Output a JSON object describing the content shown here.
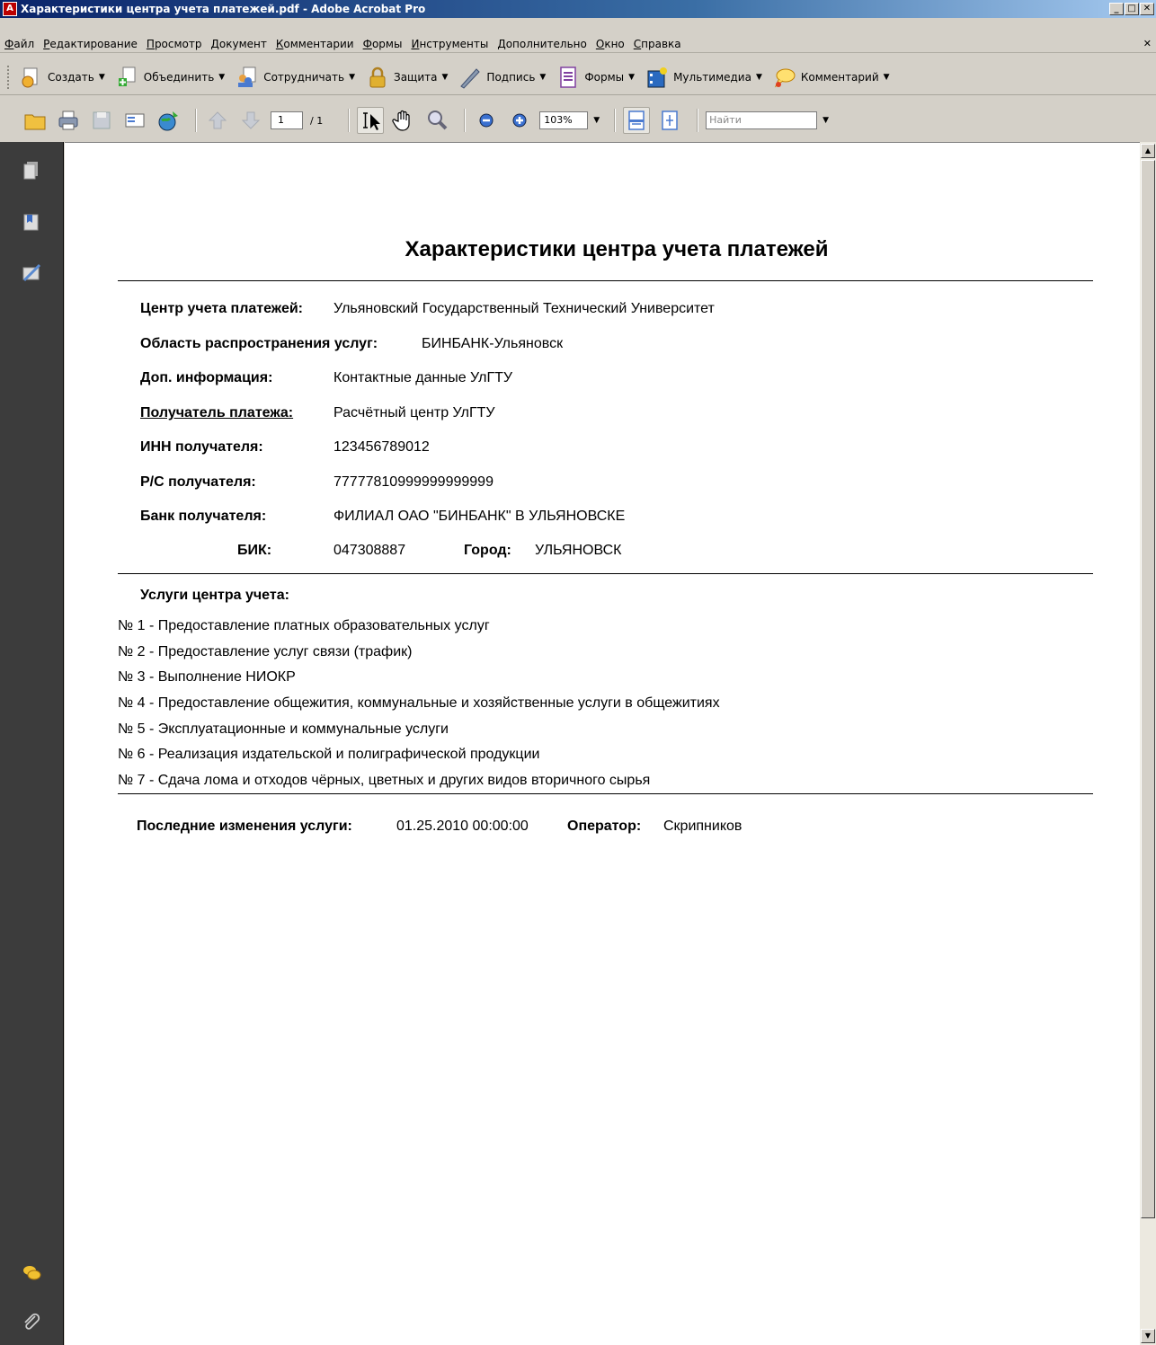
{
  "window": {
    "title": "Характеристики центра учета платежей.pdf - Adobe Acrobat Pro"
  },
  "menu": {
    "items": [
      "Файл",
      "Редактирование",
      "Просмотр",
      "Документ",
      "Комментарии",
      "Формы",
      "Инструменты",
      "Дополнительно",
      "Окно",
      "Справка"
    ]
  },
  "task_toolbar": {
    "items": [
      {
        "label": "Создать",
        "icon": "create-pdf-icon"
      },
      {
        "label": "Объединить",
        "icon": "combine-icon"
      },
      {
        "label": "Сотрудничать",
        "icon": "collaborate-icon"
      },
      {
        "label": "Защита",
        "icon": "lock-icon"
      },
      {
        "label": "Подпись",
        "icon": "pen-icon"
      },
      {
        "label": "Формы",
        "icon": "forms-icon"
      },
      {
        "label": "Мультимедиа",
        "icon": "multimedia-icon"
      },
      {
        "label": "Комментарий",
        "icon": "comment-icon"
      }
    ]
  },
  "nav_toolbar": {
    "page_current": "1",
    "page_total": "/ 1",
    "zoom": "103%",
    "find_placeholder": "Найти"
  },
  "document": {
    "title": "Характеристики центра учета платежей",
    "fields": {
      "center_label": "Центр учета платежей:",
      "center_value": "Ульяновский Государственный Технический Университет",
      "area_label": "Область распространения услуг:",
      "area_value": "БИНБАНК-Ульяновск",
      "info_label": "Доп. информация:",
      "info_value": "Контактные данные УлГТУ",
      "recipient_label": "Получатель платежа:",
      "recipient_value": "Расчётный центр УлГТУ",
      "inn_label": "ИНН получателя:",
      "inn_value": "123456789012",
      "rs_label": "Р/С получателя:",
      "rs_value": "77777810999999999999",
      "bank_label": "Банк получателя:",
      "bank_value": "ФИЛИАЛ ОАО \"БИНБАНК\" В УЛЬЯНОВСКЕ",
      "bik_label": "БИК:",
      "bik_value": "047308887",
      "city_label": "Город:",
      "city_value": "УЛЬЯНОВСК"
    },
    "services_heading": "Услуги центра учета:",
    "services": [
      "№ 1 - Предоставление платных образовательных услуг",
      "№ 2 - Предоставление услуг связи (трафик)",
      "№ 3 - Выполнение НИОКР",
      "№ 4 - Предоставление общежития, коммунальные и хозяйственные услуги в общежитиях",
      "№ 5 - Эксплуатационные и коммунальные услуги",
      "№ 6 - Реализация издательской и полиграфической продукции",
      "№ 7 - Сдача лома и отходов чёрных, цветных и других видов вторичного сырья"
    ],
    "footer": {
      "changed_label": "Последние изменения услуги:",
      "changed_value": "01.25.2010 00:00:00",
      "operator_label": "Оператор:",
      "operator_value": "Скрипников"
    }
  }
}
